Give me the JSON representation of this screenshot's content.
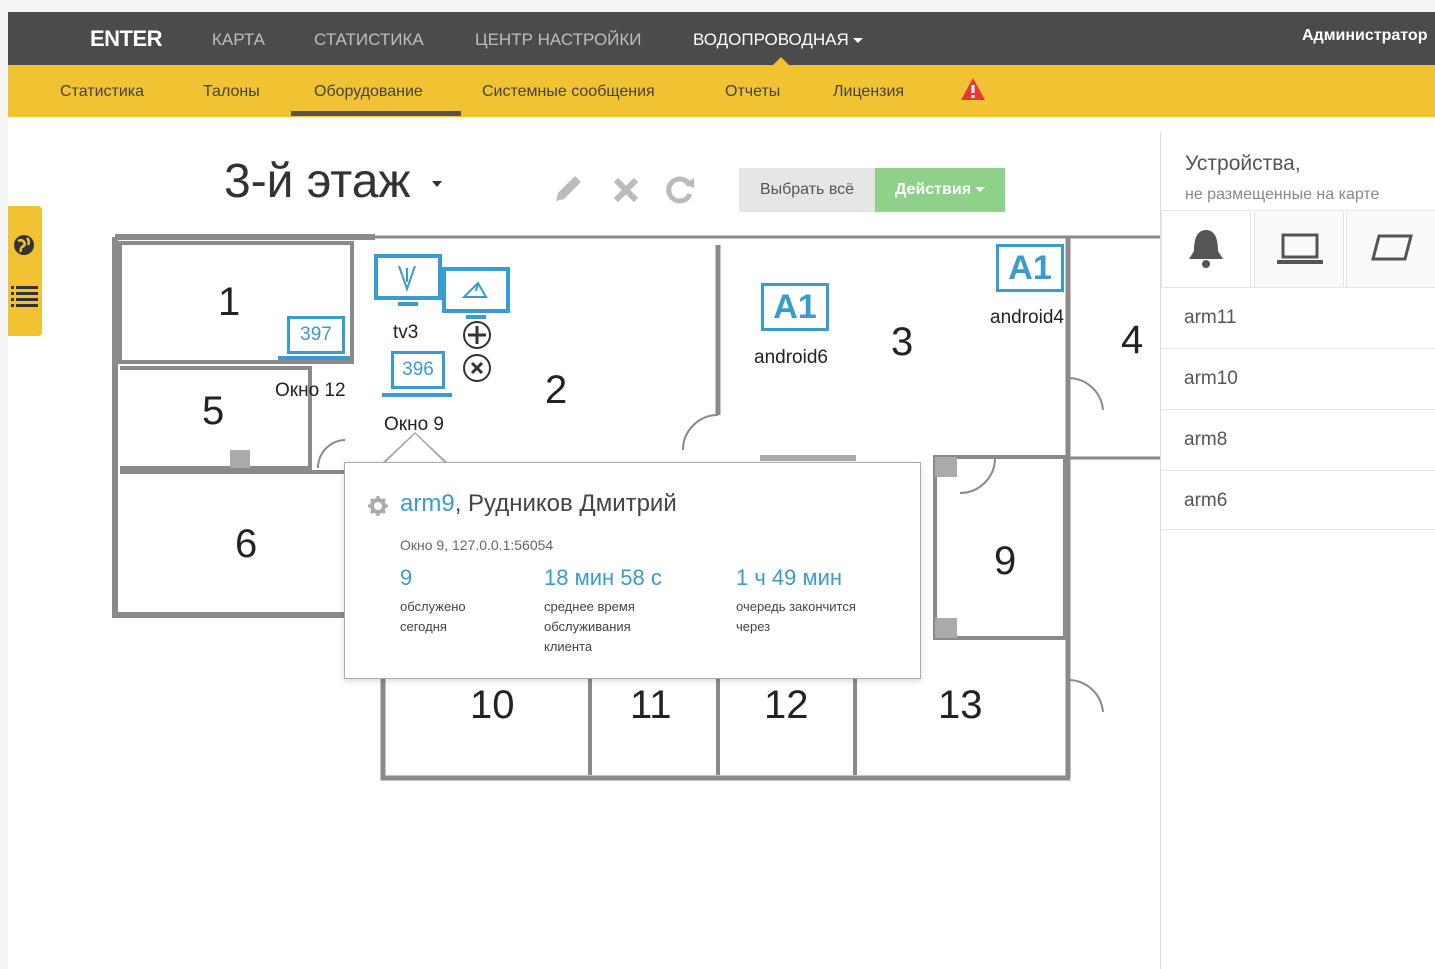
{
  "nav": {
    "logo": "ENTER",
    "items": [
      {
        "label": "КАРТА"
      },
      {
        "label": "СТАТИСТИКА"
      },
      {
        "label": "ЦЕНТР НАСТРОЙКИ"
      },
      {
        "label": "ВОДОПРОВОДНАЯ"
      }
    ],
    "user": "Администратор"
  },
  "subnav": {
    "items": [
      {
        "label": "Статистика"
      },
      {
        "label": "Талоны"
      },
      {
        "label": "Оборудование"
      },
      {
        "label": "Системные сообщения"
      },
      {
        "label": "Отчеты"
      },
      {
        "label": "Лицензия"
      }
    ],
    "active": "Оборудование"
  },
  "toolbar": {
    "floor": "3-й этаж",
    "select_all": "Выбрать всё",
    "actions": "Действия"
  },
  "map": {
    "rooms": [
      "1",
      "2",
      "3",
      "4",
      "5",
      "6",
      "9",
      "10",
      "11",
      "12",
      "13"
    ],
    "devices": {
      "tv3": "tv3",
      "w397": "397",
      "w397_label": "Окно 12",
      "w396": "396",
      "w396_label": "Окно 9",
      "a1_badge": "A1",
      "android6": "android6",
      "android4": "android4"
    }
  },
  "tooltip": {
    "arm": "arm9",
    "name": ", Рудников Дмитрий",
    "detail": "Окно 9, 127.0.0.1:56054",
    "stats": [
      {
        "value": "9",
        "label1": "обслужено",
        "label2": "сегодня",
        "label3": ""
      },
      {
        "value": "18 мин 58 с",
        "label1": "среднее время",
        "label2": "обслуживания",
        "label3": "клиента"
      },
      {
        "value": "1 ч 49 мин",
        "label1": "очередь закончится",
        "label2": "через",
        "label3": ""
      }
    ]
  },
  "panel": {
    "title": "Устройства,",
    "subtitle": "не размещенные на карте",
    "items": [
      {
        "label": "arm11"
      },
      {
        "label": "arm10"
      },
      {
        "label": "arm8"
      },
      {
        "label": "arm6"
      }
    ]
  },
  "colors": {
    "topbar": "#4b4b4b",
    "subbar": "#f1c232",
    "accent": "#3a9ad2",
    "action": "#8fd18a",
    "warning": "#e53935"
  },
  "icons": {
    "globe": "globe-icon",
    "list": "list-icon",
    "edit": "pencil-icon",
    "delete": "close-icon",
    "refresh": "refresh-icon",
    "warning": "warning-icon",
    "bell": "bell-icon",
    "laptop": "laptop-icon",
    "tablet": "tablet-icon",
    "gear": "gear-icon",
    "move": "move-icon",
    "remove": "remove-icon"
  }
}
